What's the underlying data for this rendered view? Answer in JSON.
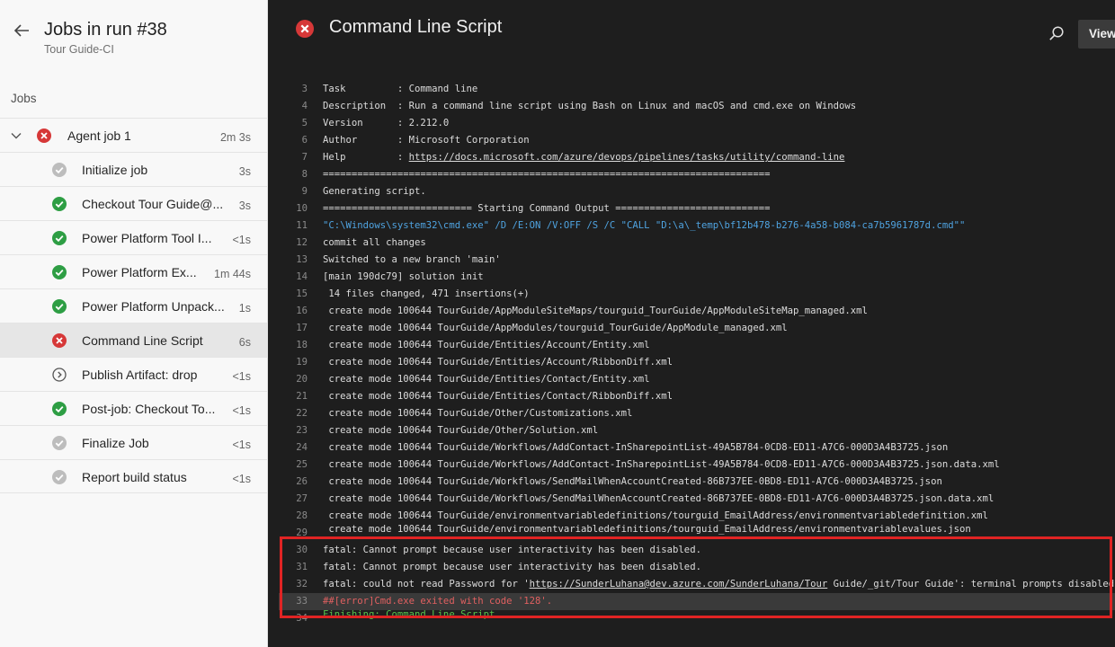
{
  "sidebar": {
    "title": "Jobs in run #38",
    "subtitle": "Tour Guide-CI",
    "jobs_heading": "Jobs",
    "agent_job": {
      "label": "Agent job 1",
      "duration": "2m 3s",
      "status": "failed"
    },
    "steps": [
      {
        "label": "Initialize job",
        "duration": "3s",
        "status": "skipped"
      },
      {
        "label": "Checkout Tour Guide@...",
        "duration": "3s",
        "status": "succeeded"
      },
      {
        "label": "Power Platform Tool I...",
        "duration": "<1s",
        "status": "succeeded"
      },
      {
        "label": "Power Platform Ex...",
        "duration": "1m 44s",
        "status": "succeeded"
      },
      {
        "label": "Power Platform Unpack...",
        "duration": "1s",
        "status": "succeeded"
      },
      {
        "label": "Command Line Script",
        "duration": "6s",
        "status": "failed",
        "selected": true
      },
      {
        "label": "Publish Artifact: drop",
        "duration": "<1s",
        "status": "not-run"
      },
      {
        "label": "Post-job: Checkout To...",
        "duration": "<1s",
        "status": "succeeded"
      },
      {
        "label": "Finalize Job",
        "duration": "<1s",
        "status": "skipped"
      },
      {
        "label": "Report build status",
        "duration": "<1s",
        "status": "skipped"
      }
    ]
  },
  "main": {
    "title": "Command Line Script",
    "view_label": "View",
    "log_lines": [
      {
        "n": "3",
        "text": "Task         : Command line"
      },
      {
        "n": "4",
        "text": "Description  : Run a command line script using Bash on Linux and macOS and cmd.exe on Windows"
      },
      {
        "n": "5",
        "text": "Version      : 2.212.0"
      },
      {
        "n": "6",
        "text": "Author       : Microsoft Corporation"
      },
      {
        "n": "7",
        "text": "Help         : ",
        "link": "https://docs.microsoft.com/azure/devops/pipelines/tasks/utility/command-line"
      },
      {
        "n": "8",
        "text": "=============================================================================="
      },
      {
        "n": "9",
        "text": "Generating script."
      },
      {
        "n": "10",
        "text": "========================== Starting Command Output ==========================="
      },
      {
        "n": "11",
        "text": "\"C:\\Windows\\system32\\cmd.exe\" /D /E:ON /V:OFF /S /C \"CALL \"D:\\a\\_temp\\bf12b478-b276-4a58-b084-ca7b5961787d.cmd\"\"",
        "style": "cmd"
      },
      {
        "n": "12",
        "text": "commit all changes"
      },
      {
        "n": "13",
        "text": "Switched to a new branch 'main'"
      },
      {
        "n": "14",
        "text": "[main 190dc79] solution init"
      },
      {
        "n": "15",
        "text": " 14 files changed, 471 insertions(+)"
      },
      {
        "n": "16",
        "text": " create mode 100644 TourGuide/AppModuleSiteMaps/tourguid_TourGuide/AppModuleSiteMap_managed.xml"
      },
      {
        "n": "17",
        "text": " create mode 100644 TourGuide/AppModules/tourguid_TourGuide/AppModule_managed.xml"
      },
      {
        "n": "18",
        "text": " create mode 100644 TourGuide/Entities/Account/Entity.xml"
      },
      {
        "n": "19",
        "text": " create mode 100644 TourGuide/Entities/Account/RibbonDiff.xml"
      },
      {
        "n": "20",
        "text": " create mode 100644 TourGuide/Entities/Contact/Entity.xml"
      },
      {
        "n": "21",
        "text": " create mode 100644 TourGuide/Entities/Contact/RibbonDiff.xml"
      },
      {
        "n": "22",
        "text": " create mode 100644 TourGuide/Other/Customizations.xml"
      },
      {
        "n": "23",
        "text": " create mode 100644 TourGuide/Other/Solution.xml"
      },
      {
        "n": "24",
        "text": " create mode 100644 TourGuide/Workflows/AddContact-InSharepointList-49A5B784-0CD8-ED11-A7C6-000D3A4B3725.json"
      },
      {
        "n": "25",
        "text": " create mode 100644 TourGuide/Workflows/AddContact-InSharepointList-49A5B784-0CD8-ED11-A7C6-000D3A4B3725.json.data.xml"
      },
      {
        "n": "26",
        "text": " create mode 100644 TourGuide/Workflows/SendMailWhenAccountCreated-86B737EE-0BD8-ED11-A7C6-000D3A4B3725.json"
      },
      {
        "n": "27",
        "text": " create mode 100644 TourGuide/Workflows/SendMailWhenAccountCreated-86B737EE-0BD8-ED11-A7C6-000D3A4B3725.json.data.xml"
      },
      {
        "n": "28",
        "text": " create mode 100644 TourGuide/environmentvariabledefinitions/tourguid_EmailAddress/environmentvariabledefinition.xml"
      },
      {
        "n": "29",
        "text": " create mode 100644 TourGuide/environmentvariabledefinitions/tourguid_EmailAddress/environmentvariablevalues.json",
        "style": "cut"
      },
      {
        "n": "30",
        "text": "fatal: Cannot prompt because user interactivity has been disabled."
      },
      {
        "n": "31",
        "text": "fatal: Cannot prompt because user interactivity has been disabled."
      },
      {
        "n": "32",
        "text": "fatal: could not read Password for '",
        "link": "https://SunderLuhana@dev.azure.com/SunderLuhana/Tour",
        "tail": " Guide/_git/Tour Guide': terminal prompts disabled"
      },
      {
        "n": "33",
        "text": "##[error]Cmd.exe exited with code '128'.",
        "style": "err",
        "highlight": true
      },
      {
        "n": "34",
        "text": "Finishing: Command Line Script",
        "style": "green cut"
      }
    ]
  },
  "colors": {
    "success": "#2e9e44",
    "error": "#d63838",
    "skipped": "#bdbdbd",
    "highlight_border": "#e02424"
  }
}
